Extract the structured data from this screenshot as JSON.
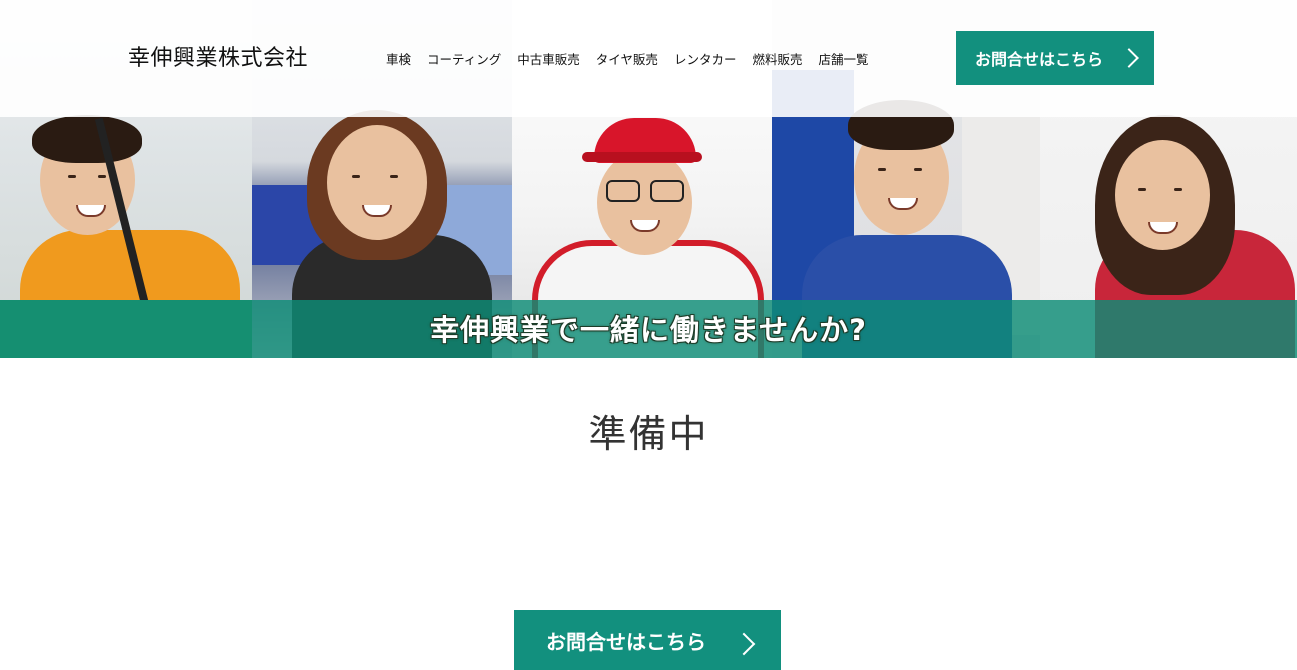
{
  "header": {
    "logo": "幸伸興業株式会社",
    "nav": [
      "車検",
      "コーティング",
      "中古車販売",
      "タイヤ販売",
      "レンタカー",
      "燃料販売",
      "店舗一覧"
    ],
    "cta": "お問合せはこちら"
  },
  "hero": {
    "banner_text": "幸伸興業で一緒に働きませんか?",
    "accent_color": "#12907e"
  },
  "main": {
    "title": "準備中",
    "cta": "お問合せはこちら"
  }
}
